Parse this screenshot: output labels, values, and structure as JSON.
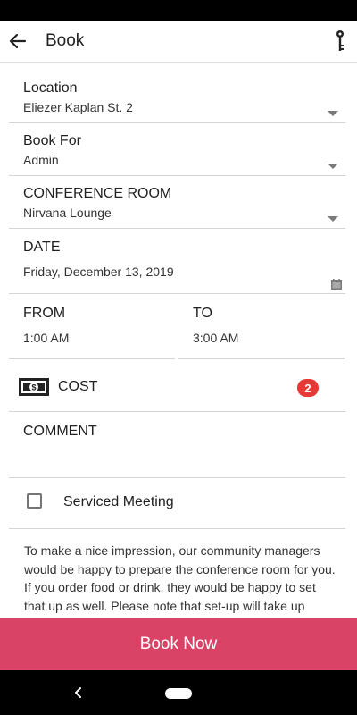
{
  "appbar": {
    "title": "Book",
    "back_icon": "arrow-left-icon",
    "key_icon": "key-icon"
  },
  "form": {
    "location": {
      "label": "Location",
      "value": "Eliezer Kaplan St. 2"
    },
    "book_for": {
      "label": "Book For",
      "value": "Admin"
    },
    "conference_room": {
      "label": "CONFERENCE ROOM",
      "value": "Nirvana Lounge"
    },
    "date": {
      "label": "DATE",
      "value": "Friday, December 13, 2019",
      "icon": "calendar-icon"
    },
    "from": {
      "label": "FROM",
      "value": "1:00 AM"
    },
    "to": {
      "label": "TO",
      "value": "3:00 AM"
    },
    "cost": {
      "label": "COST",
      "badge": "2",
      "icon": "cash-icon"
    },
    "comment": {
      "label": "COMMENT",
      "value": ""
    },
    "serviced_meeting": {
      "label": "Serviced Meeting",
      "checked": false
    },
    "description": "To make a nice impression, our community managers would be happy to prepare the conference room for you. If you order food or drink, they would be happy to set that up as well. Please note that set-up will take up"
  },
  "actions": {
    "book_now": "Book Now"
  },
  "colors": {
    "accent": "#d94466",
    "badge": "#e53935"
  }
}
